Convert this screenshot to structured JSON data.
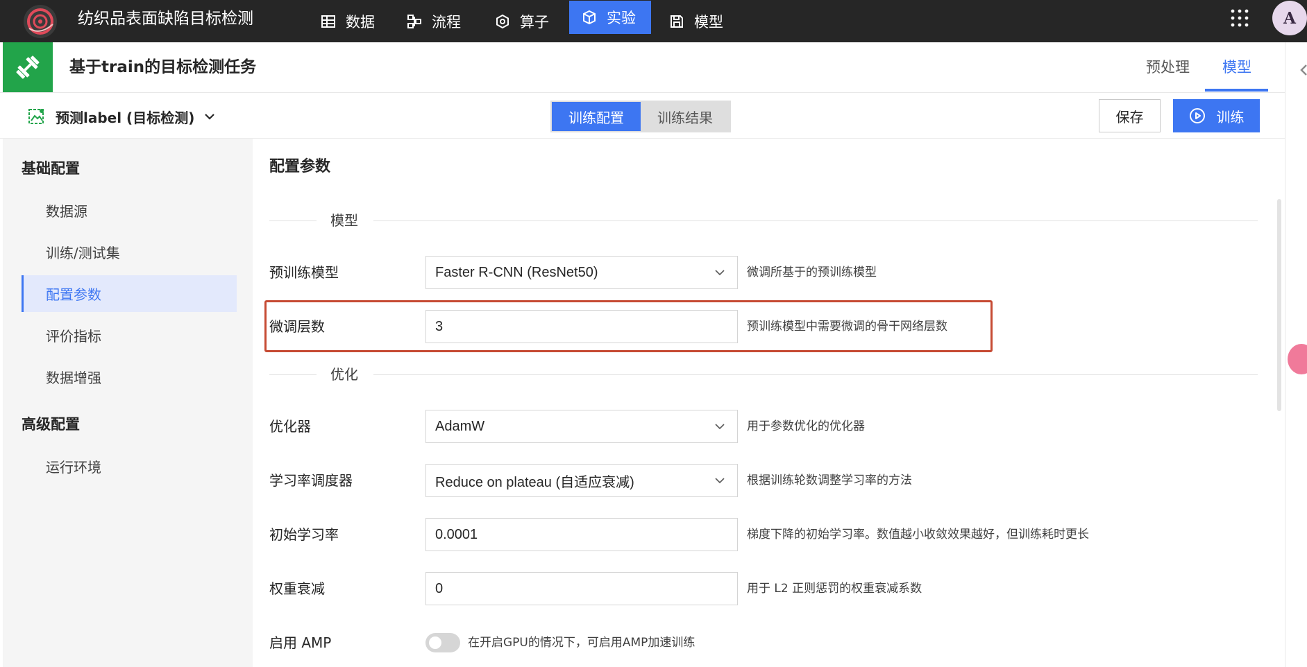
{
  "app": {
    "title": "纺织品表面缺陷目标检测",
    "user_initial": "A"
  },
  "nav": [
    {
      "label": "数据",
      "icon": "table-icon"
    },
    {
      "label": "流程",
      "icon": "flow-icon"
    },
    {
      "label": "算子",
      "icon": "operator-icon"
    },
    {
      "label": "实验",
      "icon": "cube-icon",
      "active": true
    },
    {
      "label": "模型",
      "icon": "save-icon"
    }
  ],
  "task": {
    "title": "基于train的目标检测任务",
    "tabs": [
      {
        "label": "预处理"
      },
      {
        "label": "模型",
        "active": true
      }
    ]
  },
  "toolbar": {
    "dataset_label": "预测label (目标检测)",
    "segments": [
      {
        "label": "训练配置",
        "active": true
      },
      {
        "label": "训练结果"
      }
    ],
    "save_label": "保存",
    "train_label": "训练"
  },
  "sidebar": {
    "groups": [
      {
        "label": "基础配置",
        "items": [
          {
            "label": "数据源"
          },
          {
            "label": "训练/测试集"
          },
          {
            "label": "配置参数",
            "active": true
          },
          {
            "label": "评价指标"
          },
          {
            "label": "数据增强"
          }
        ]
      },
      {
        "label": "高级配置",
        "items": [
          {
            "label": "运行环境"
          }
        ]
      }
    ]
  },
  "main": {
    "title": "配置参数",
    "sections": [
      {
        "label": "模型",
        "fields": [
          {
            "label": "预训练模型",
            "type": "select",
            "value": "Faster R-CNN (ResNet50)",
            "hint": "微调所基于的预训练模型"
          },
          {
            "label": "微调层数",
            "type": "input",
            "value": "3",
            "hint": "预训练模型中需要微调的骨干网络层数",
            "highlighted": true
          }
        ]
      },
      {
        "label": "优化",
        "fields": [
          {
            "label": "优化器",
            "type": "select",
            "value": "AdamW",
            "hint": "用于参数优化的优化器"
          },
          {
            "label": "学习率调度器",
            "type": "select",
            "value": "Reduce on plateau (自适应衰减)",
            "hint": "根据训练轮数调整学习率的方法"
          },
          {
            "label": "初始学习率",
            "type": "input",
            "value": "0.0001",
            "hint": "梯度下降的初始学习率。数值越小收敛效果越好，但训练耗时更长"
          },
          {
            "label": "权重衰减",
            "type": "input",
            "value": "0",
            "hint": "用于 L2 正则惩罚的权重衰减系数"
          },
          {
            "label": "启用 AMP",
            "type": "toggle",
            "value": false,
            "hint": "在开启GPU的情况下，可启用AMP加速训练"
          }
        ]
      }
    ]
  },
  "colors": {
    "accent": "#3d76f2",
    "topbar": "#262626",
    "task_icon_bg": "#22a44a",
    "highlight": "#c64a33",
    "sidebar_bg": "#f5f5f5"
  }
}
